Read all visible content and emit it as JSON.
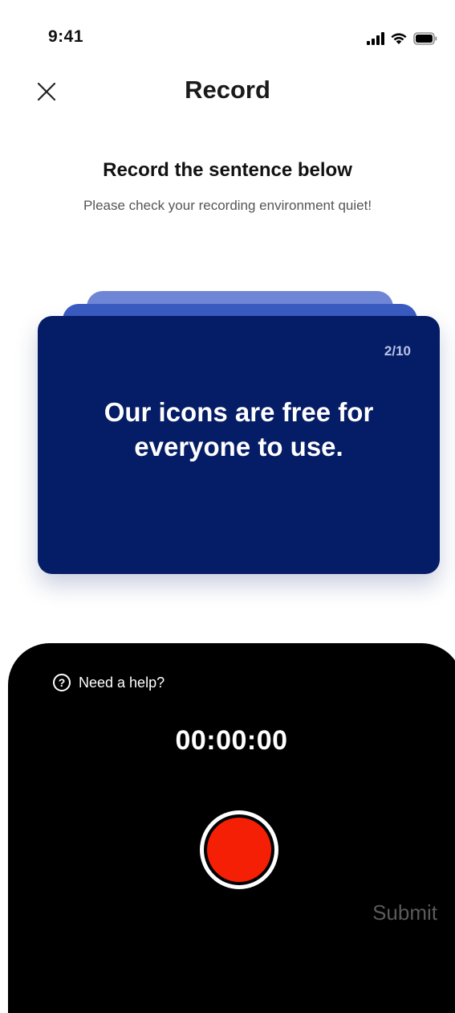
{
  "status_bar": {
    "time": "9:41",
    "icons": [
      "signal-icon",
      "wifi-icon",
      "battery-icon"
    ]
  },
  "header": {
    "title": "Record",
    "close_icon": "close-icon"
  },
  "instructions": {
    "title": "Record the sentence below",
    "subtitle": "Please check your recording environment quiet!"
  },
  "card": {
    "counter": "2/10",
    "current": 2,
    "total": 10,
    "sentence": "Our icons are free for everyone to use."
  },
  "recorder": {
    "help_label": "Need a help?",
    "help_icon": "question-circle-icon",
    "timer": "00:00:00",
    "record_icon": "record-icon",
    "submit_label": "Submit"
  },
  "colors": {
    "card_main": "#051c66",
    "card_back_1": "#3a5bc0",
    "card_back_2": "#6f86d6",
    "panel_bg": "#000000",
    "record_red": "#f51f05",
    "submit_disabled": "#5a5a5a"
  }
}
